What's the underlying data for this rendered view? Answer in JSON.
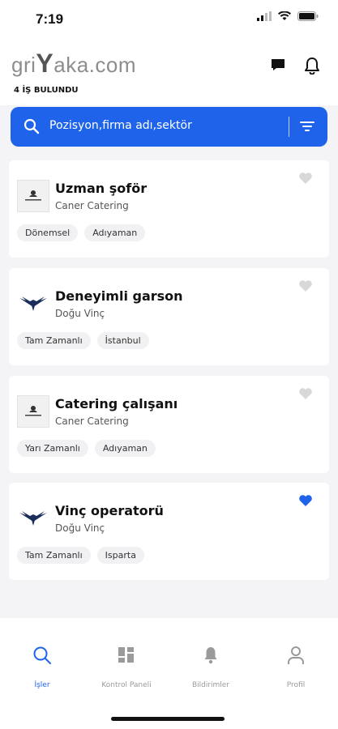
{
  "status": {
    "time": "7:19"
  },
  "header": {
    "logo_pre": "gri",
    "logo_y": "Y",
    "logo_post": "aka.com",
    "count": "4 İŞ BULUNDU"
  },
  "search": {
    "placeholder": "Pozisyon,firma adı,sektör"
  },
  "jobs": [
    {
      "title": "Uzman şoför",
      "company": "Caner Catering",
      "tags": [
        "Dönemsel",
        "Adıyaman"
      ],
      "liked": false,
      "logo": "caner-catering"
    },
    {
      "title": "Deneyimli garson",
      "company": "Doğu Vinç",
      "tags": [
        "Tam Zamanlı",
        "İstanbul"
      ],
      "liked": false,
      "logo": "dogu-vinc"
    },
    {
      "title": "Catering çalışanı",
      "company": "Caner Catering",
      "tags": [
        "Yarı Zamanlı",
        "Adıyaman"
      ],
      "liked": false,
      "logo": "caner-catering"
    },
    {
      "title": "Vinç operatorü",
      "company": "Doğu Vinç",
      "tags": [
        "Tam Zamanlı",
        "Isparta"
      ],
      "liked": true,
      "logo": "dogu-vinc"
    }
  ],
  "nav": [
    {
      "label": "İşler",
      "icon": "search-icon",
      "active": true
    },
    {
      "label": "Kontrol Paneli",
      "icon": "dashboard-icon",
      "active": false
    },
    {
      "label": "Bildirimler",
      "icon": "bell-icon",
      "active": false
    },
    {
      "label": "Profil",
      "icon": "user-icon",
      "active": false
    }
  ],
  "colors": {
    "accent": "#1e63e9",
    "liked": "#1e63e9",
    "unliked": "#d8d8d8"
  }
}
